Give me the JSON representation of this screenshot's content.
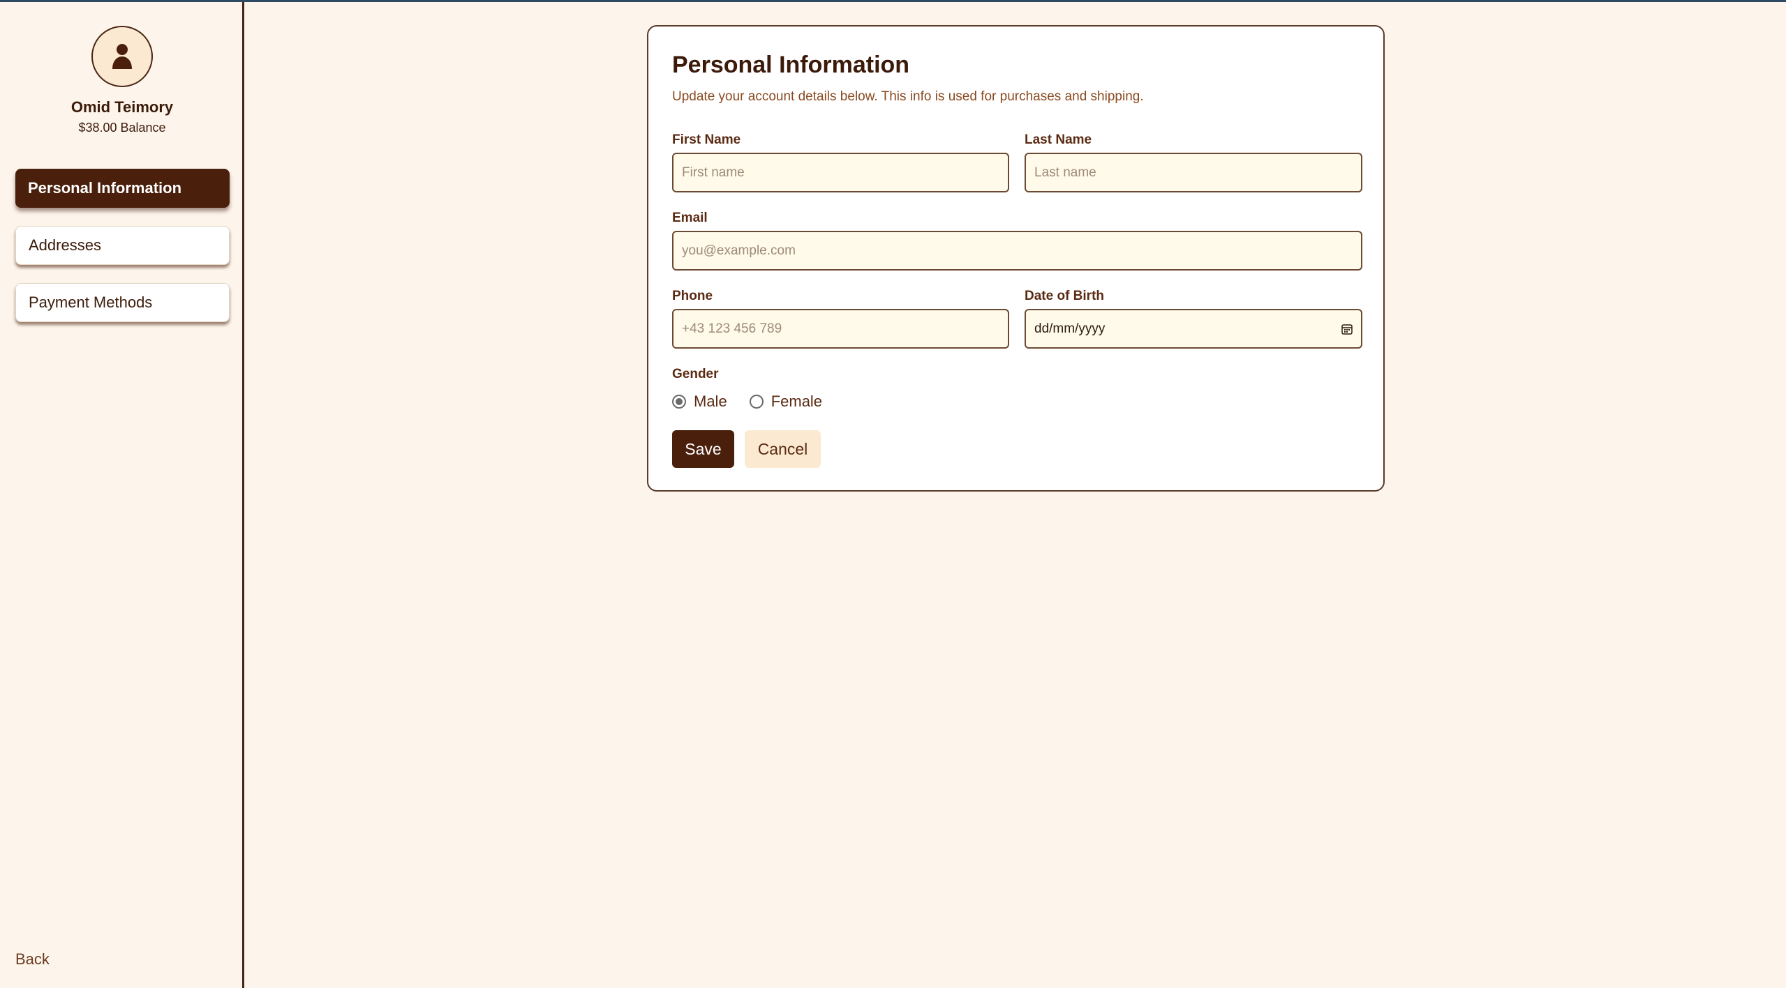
{
  "sidebar": {
    "user": {
      "name": "Omid Teimory",
      "balance": "$38.00 Balance",
      "avatar_icon": "user-icon"
    },
    "items": [
      {
        "label": "Personal Information",
        "active": true
      },
      {
        "label": "Addresses",
        "active": false
      },
      {
        "label": "Payment Methods",
        "active": false
      }
    ],
    "back_label": "Back"
  },
  "form": {
    "title": "Personal Information",
    "subtitle": "Update your account details below. This info is used for purchases and shipping.",
    "first_name": {
      "label": "First Name",
      "placeholder": "First name",
      "value": ""
    },
    "last_name": {
      "label": "Last Name",
      "placeholder": "Last name",
      "value": ""
    },
    "email": {
      "label": "Email",
      "placeholder": "you@example.com",
      "value": ""
    },
    "phone": {
      "label": "Phone",
      "placeholder": "+43 123 456 789",
      "value": ""
    },
    "dob": {
      "label": "Date of Birth",
      "value": "dd/mm/yyyy",
      "icon": "calendar-icon"
    },
    "gender": {
      "label": "Gender",
      "options": [
        "Male",
        "Female"
      ],
      "selected": "Male"
    },
    "save_label": "Save",
    "cancel_label": "Cancel"
  },
  "colors": {
    "background": "#fdf5ec",
    "accent": "#4a1f0c",
    "input_bg": "#fffaea",
    "topbar": "#2f4a63"
  }
}
